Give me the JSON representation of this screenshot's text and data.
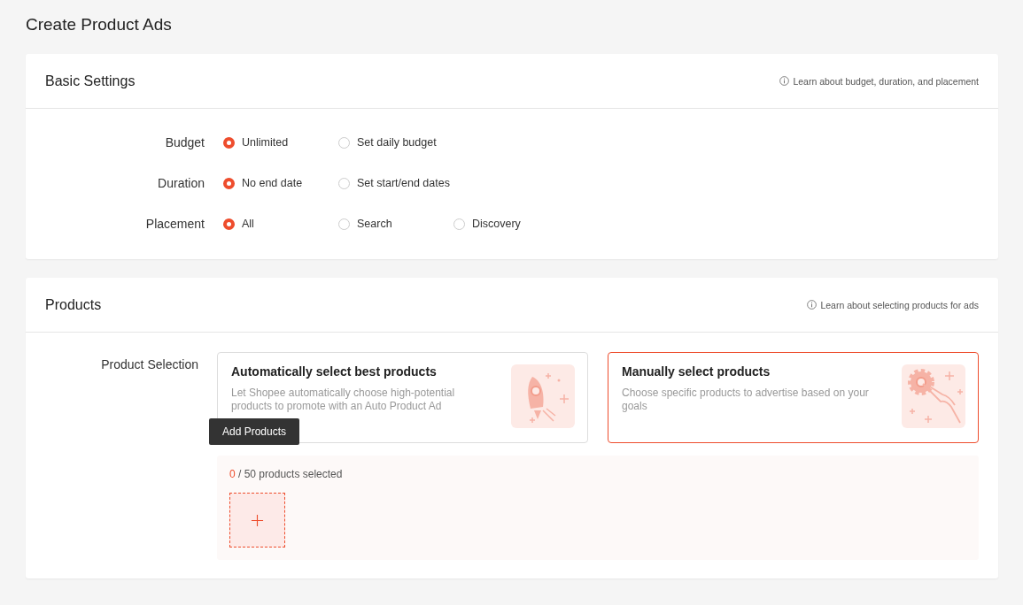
{
  "page_title": "Create Product Ads",
  "basic_settings": {
    "title": "Basic Settings",
    "help_link": "Learn about budget, duration, and placement",
    "rows": [
      {
        "label": "Budget",
        "options": [
          {
            "label": "Unlimited",
            "selected": true
          },
          {
            "label": "Set daily budget",
            "selected": false
          }
        ]
      },
      {
        "label": "Duration",
        "options": [
          {
            "label": "No end date",
            "selected": true
          },
          {
            "label": "Set start/end dates",
            "selected": false
          }
        ]
      },
      {
        "label": "Placement",
        "options": [
          {
            "label": "All",
            "selected": true
          },
          {
            "label": "Search",
            "selected": false
          },
          {
            "label": "Discovery",
            "selected": false
          }
        ]
      }
    ]
  },
  "products": {
    "title": "Products",
    "help_link": "Learn about selecting products for ads",
    "selection_label": "Product Selection",
    "choices": [
      {
        "kind": "rocket",
        "title": "Automatically select best products",
        "description": "Let Shopee automatically choose high-potential products to promote with an Auto Product Ad",
        "selected": false
      },
      {
        "kind": "gear",
        "title": "Manually select products",
        "description": "Choose specific products to advertise based on your goals",
        "selected": true
      }
    ],
    "selected_count": "0",
    "limit_text": "/ 50 products selected",
    "tooltip": "Add Products"
  }
}
